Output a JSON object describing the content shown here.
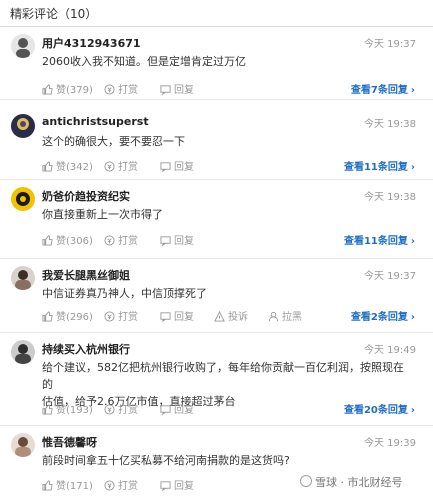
{
  "header": {
    "title": "精彩评论（10）"
  },
  "comments": [
    {
      "user": "用户4312943671",
      "time": "今天 19:37",
      "lines": [
        "2060收入我不知道。但是定增肯定过万亿"
      ],
      "like": "赞(379)",
      "tip": "打赏",
      "reply": "回复",
      "replies": "查看7条回复"
    },
    {
      "user": "antichristsuperst",
      "time": "今天 19:38",
      "lines": [
        "这个的确很大，要不要忍一下"
      ],
      "like": "赞(342)",
      "tip": "打赏",
      "reply": "回复",
      "replies": "查看11条回复"
    },
    {
      "user": "奶爸价趋投资纪实",
      "time": "今天 19:38",
      "lines": [
        "你直接重新上一次市得了"
      ],
      "like": "赞(306)",
      "tip": "打赏",
      "reply": "回复",
      "replies": "查看11条回复"
    },
    {
      "user": "我爱长腿黑丝御姐",
      "time": "今天 19:37",
      "lines": [
        "中信证券真乃神人，中信顶撑死了"
      ],
      "like": "赞(296)",
      "tip": "打赏",
      "report": "投诉",
      "block": "拉黑",
      "reply": "回复",
      "replies": "查看2条回复"
    },
    {
      "user": "持续买入杭州银行",
      "time": "今天 19:49",
      "lines": [
        "给个建议，582亿把杭州银行收购了，每年给你贡献一百亿利润，按照现在的",
        "估值，给予2.6万亿市值，直接超过茅台"
      ],
      "like": "赞(193)",
      "tip": "打赏",
      "reply": "回复",
      "replies": "查看20条回复"
    },
    {
      "user": "惟吾德馨呀",
      "time": "今天 19:39",
      "lines": [
        "前段时间拿五十亿买私募不给河南捐款的是这货吗?"
      ],
      "like": "赞(171)",
      "tip": "打赏",
      "reply": "回复",
      "replies": ""
    }
  ],
  "watermark": "雪球 · 市北财经号",
  "colors": {
    "link": "#1f6fc5",
    "muted": "#999999",
    "divider": "#e8e8e8"
  }
}
